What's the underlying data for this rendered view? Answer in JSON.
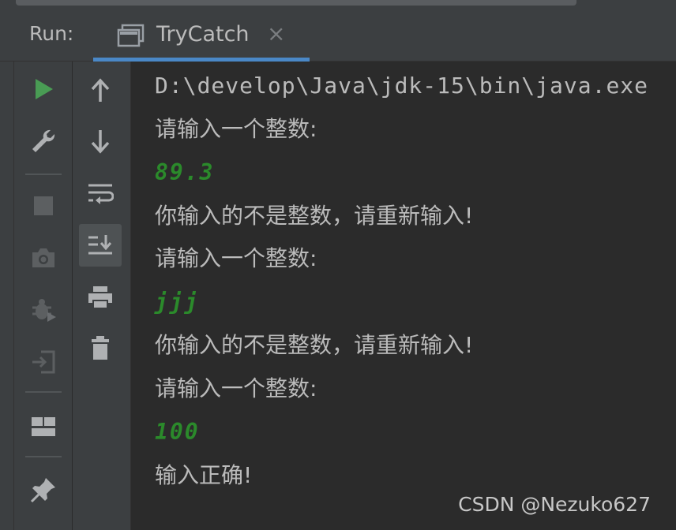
{
  "header": {
    "run_label": "Run:",
    "tab": {
      "label": "TryCatch",
      "close": "×",
      "icon": "console-window-icon"
    }
  },
  "toolbar_primary": [
    {
      "name": "rerun-icon",
      "color": "#499c54"
    },
    {
      "name": "wrench-icon"
    },
    {
      "name": "stop-icon",
      "disabled": true
    },
    {
      "name": "camera-icon",
      "disabled": true
    },
    {
      "name": "debug-bug-icon",
      "disabled": true
    },
    {
      "name": "exit-icon",
      "disabled": true
    },
    {
      "name": "layout-icon"
    },
    {
      "name": "pin-icon"
    }
  ],
  "toolbar_secondary": [
    {
      "name": "up-arrow-icon"
    },
    {
      "name": "down-arrow-icon"
    },
    {
      "name": "soft-wrap-icon"
    },
    {
      "name": "scroll-to-end-icon",
      "active": true
    },
    {
      "name": "print-icon"
    },
    {
      "name": "trash-icon"
    }
  ],
  "console": {
    "lines": [
      {
        "text": "D:\\develop\\Java\\jdk-15\\bin\\java.exe",
        "kind": "command"
      },
      {
        "text": "请输入一个整数:",
        "kind": "output"
      },
      {
        "text": "89.3",
        "kind": "input"
      },
      {
        "text": "你输入的不是整数，请重新输入!",
        "kind": "output"
      },
      {
        "text": "请输入一个整数:",
        "kind": "output"
      },
      {
        "text": "jjj",
        "kind": "input"
      },
      {
        "text": "你输入的不是整数，请重新输入!",
        "kind": "output"
      },
      {
        "text": "请输入一个整数:",
        "kind": "output"
      },
      {
        "text": "100",
        "kind": "input"
      },
      {
        "text": "输入正确!",
        "kind": "output"
      }
    ]
  },
  "watermark": "CSDN @Nezuko627",
  "colors": {
    "background": "#2b2b2b",
    "panel": "#3c3f41",
    "accent": "#4a88c7",
    "input_text": "#2b8a2b",
    "output_text": "#bbbbbb",
    "run_green": "#499c54"
  }
}
